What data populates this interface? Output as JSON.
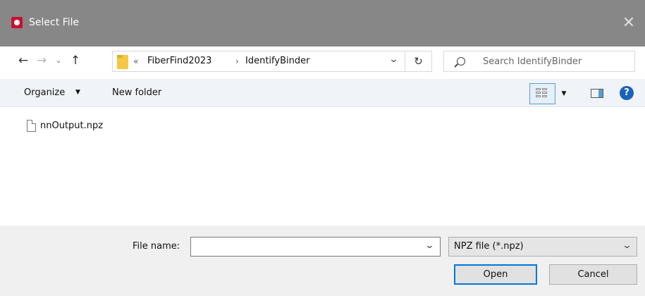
{
  "titlebar": {
    "title": "Select File",
    "close_symbol": "✕",
    "app_icon": "app-logo-icon"
  },
  "nav": {
    "back_symbol": "←",
    "forward_symbol": "→",
    "recent_symbol": "⌄",
    "up_symbol": "↑",
    "refresh_symbol": "↻"
  },
  "address": {
    "overflow_symbol": "«",
    "breadcrumbs": [
      "FiberFind2023",
      "IdentifyBinder"
    ],
    "separator": "›",
    "dropdown_symbol": "⌄"
  },
  "search": {
    "placeholder": "Search IdentifyBinder"
  },
  "commands": {
    "organize_label": "Organize",
    "organize_caret": "▼",
    "new_folder_label": "New folder",
    "view_dropdown_symbol": "▼",
    "help_symbol": "?"
  },
  "files": [
    {
      "name": "nnOutput.npz"
    }
  ],
  "bottom": {
    "file_name_label": "File name:",
    "file_name_value": "",
    "file_name_dropdown": "⌄",
    "filter_value": "NPZ file (*.npz)",
    "filter_dropdown": "⌄",
    "open_label": "Open",
    "cancel_label": "Cancel"
  },
  "colors": {
    "titlebar": "#878787",
    "accent": "#0078d7",
    "help": "#1a63b8",
    "folder": "#f5c843"
  }
}
